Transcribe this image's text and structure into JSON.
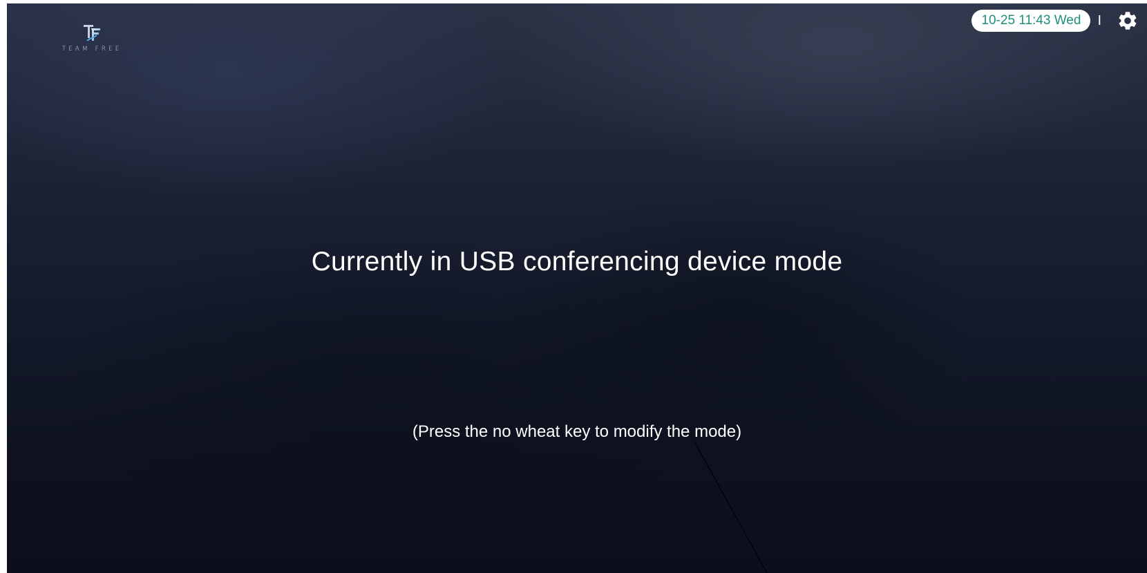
{
  "header": {
    "logo_text": "TEAM FREE",
    "logo_icon": "tf-logo-icon",
    "datetime": "10-25 11:43 Wed",
    "separator": "I",
    "settings_icon": "gear-icon"
  },
  "main": {
    "headline": "Currently in USB conferencing device mode",
    "hint": "(Press the no wheat key to modify the mode)"
  },
  "colors": {
    "clock_text": "#1f8f7a",
    "clock_bg": "#ffffff",
    "text": "#ffffff",
    "background_top": "#2b3246",
    "background_bottom": "#0b0f1c"
  }
}
